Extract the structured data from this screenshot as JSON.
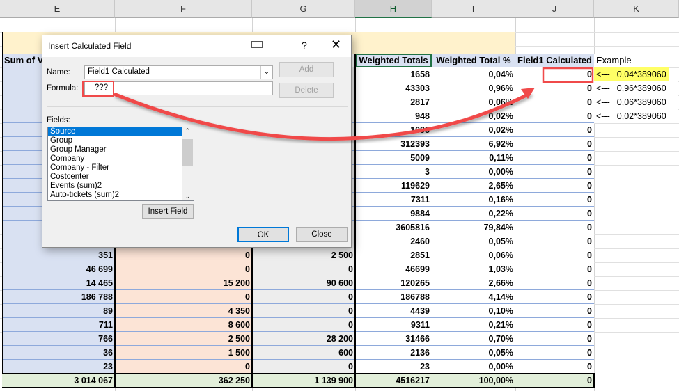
{
  "columns": [
    "E",
    "F",
    "G",
    "H",
    "I",
    "J",
    "K"
  ],
  "headers": {
    "e": "Sum of V",
    "h": "Weighted Totals",
    "i": "Weighted Total %",
    "j": "Field1 Calculated",
    "k": "Example"
  },
  "rows": [
    {
      "e": "",
      "f": "",
      "g": "",
      "h": "1658",
      "i": "0,04%",
      "j": "0"
    },
    {
      "e": "",
      "f": "",
      "g": "",
      "h": "43303",
      "i": "0,96%",
      "j": "0"
    },
    {
      "e": "",
      "f": "",
      "g": "",
      "h": "2817",
      "i": "0,06%",
      "j": "0"
    },
    {
      "e": "",
      "f": "",
      "g": "",
      "h": "948",
      "i": "0,02%",
      "j": "0"
    },
    {
      "e": "",
      "f": "",
      "g": "",
      "h": "1098",
      "i": "0,02%",
      "j": "0"
    },
    {
      "e": "",
      "f": "",
      "g": "",
      "h": "312393",
      "i": "6,92%",
      "j": "0"
    },
    {
      "e": "",
      "f": "",
      "g": "",
      "h": "5009",
      "i": "0,11%",
      "j": "0"
    },
    {
      "e": "",
      "f": "",
      "g": "",
      "h": "3",
      "i": "0,00%",
      "j": "0"
    },
    {
      "e": "",
      "f": "",
      "g": "",
      "h": "119629",
      "i": "2,65%",
      "j": "0"
    },
    {
      "e": "",
      "f": "",
      "g": "",
      "h": "7311",
      "i": "0,16%",
      "j": "0"
    },
    {
      "e": "",
      "f": "",
      "g": "",
      "h": "9884",
      "i": "0,22%",
      "j": "0"
    },
    {
      "e": "",
      "f": "",
      "g": "",
      "h": "3605816",
      "i": "79,84%",
      "j": "0"
    },
    {
      "e": "",
      "f": "",
      "g": "",
      "h": "2460",
      "i": "0,05%",
      "j": "0"
    },
    {
      "e": "351",
      "f": "0",
      "g": "2 500",
      "h": "2851",
      "i": "0,06%",
      "j": "0"
    },
    {
      "e": "46 699",
      "f": "0",
      "g": "0",
      "h": "46699",
      "i": "1,03%",
      "j": "0"
    },
    {
      "e": "14 465",
      "f": "15 200",
      "g": "90 600",
      "h": "120265",
      "i": "2,66%",
      "j": "0"
    },
    {
      "e": "186 788",
      "f": "0",
      "g": "0",
      "h": "186788",
      "i": "4,14%",
      "j": "0"
    },
    {
      "e": "89",
      "f": "4 350",
      "g": "0",
      "h": "4439",
      "i": "0,10%",
      "j": "0"
    },
    {
      "e": "711",
      "f": "8 600",
      "g": "0",
      "h": "9311",
      "i": "0,21%",
      "j": "0"
    },
    {
      "e": "766",
      "f": "2 500",
      "g": "28 200",
      "h": "31466",
      "i": "0,70%",
      "j": "0"
    },
    {
      "e": "36",
      "f": "1 500",
      "g": "600",
      "h": "2136",
      "i": "0,05%",
      "j": "0"
    },
    {
      "e": "23",
      "f": "0",
      "g": "0",
      "h": "23",
      "i": "0,00%",
      "j": "0"
    }
  ],
  "total": {
    "e": "3 014 067",
    "f": "362 250",
    "g": "1 139 900",
    "h": "4516217",
    "i": "100,00%",
    "j": "0"
  },
  "examples": [
    {
      "arrow": "<---",
      "text": "0,04*389060"
    },
    {
      "arrow": "<---",
      "text": "0,96*389060"
    },
    {
      "arrow": "<---",
      "text": "0,06*389060"
    },
    {
      "arrow": "<---",
      "text": "0,02*389060"
    }
  ],
  "dialog": {
    "title": "Insert Calculated Field",
    "help": "?",
    "name_label": "Name:",
    "name_value": "Field1 Calculated",
    "formula_label": "Formula:",
    "formula_value": "= ???",
    "add": "Add",
    "delete": "Delete",
    "fields_label": "Fields:",
    "fields": [
      "Source",
      "Group",
      "Group Manager",
      "Company",
      "Company - Filter",
      "Costcenter",
      "Events (sum)2",
      "Auto-tickets (sum)2"
    ],
    "insert_field": "Insert Field",
    "ok": "OK",
    "close": "Close"
  },
  "colors": {
    "annotation": "#f04a4a",
    "highlight": "#ffff66"
  }
}
